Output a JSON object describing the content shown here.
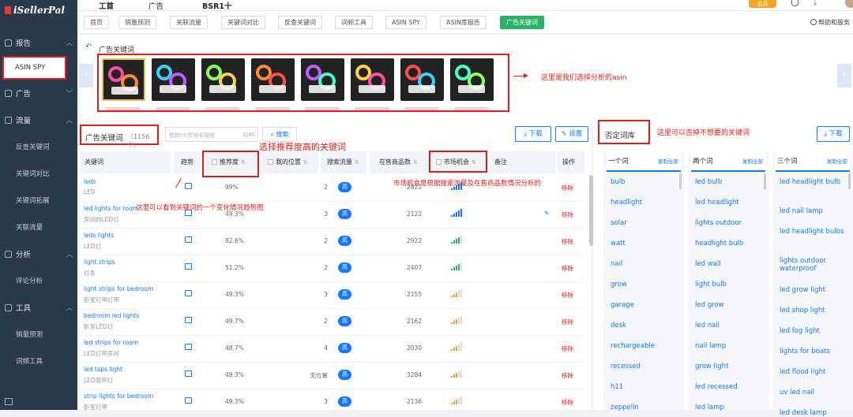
{
  "brand": {
    "name": "iSellerPal"
  },
  "sidebar": {
    "sections": [
      {
        "label": "报告",
        "items": [
          {
            "label": "ASIN SPY",
            "active": true
          }
        ]
      },
      {
        "label": "广告",
        "items": []
      },
      {
        "label": "流量",
        "items": [
          {
            "label": "反查关键词"
          },
          {
            "label": "关键词对比"
          },
          {
            "label": "关键词拓展"
          },
          {
            "label": "关联流量"
          }
        ]
      },
      {
        "label": "分析",
        "items": [
          {
            "label": "评论分析"
          }
        ]
      },
      {
        "label": "工具",
        "items": [
          {
            "label": "销量预测"
          },
          {
            "label": "词频工具"
          }
        ]
      }
    ]
  },
  "topbar": {
    "tabs": [
      "工首",
      "广告",
      "BSR1十"
    ],
    "vip_label": "会员",
    "user_badge": "..."
  },
  "nav": {
    "tabs": [
      "首页",
      "销量预测",
      "关联流量",
      "关键词对比",
      "反查关键词",
      "词频工具",
      "ASIN SPY",
      "ASIN库报告",
      "广告关键词"
    ],
    "active_index": 8,
    "help": "帮助和服务"
  },
  "products": {
    "title": "广告关键词",
    "count": 8,
    "annotation": "这里是我们选择分析的asin"
  },
  "keywords": {
    "title": "广告关键词",
    "count_label": "（1156个）",
    "search_placeholder": "模糊/大类搜索搜索",
    "search_count": "0/40",
    "search_btn": "搜索",
    "download": "下载",
    "settings": "设置",
    "annotation_rec": "选择推荐度高的关键词",
    "annotation_market": "市场机会是根据搜索流量及在售商品数情况分析的",
    "annotation_trend": "这里可以看到关键词的一个变化情况趋势图",
    "columns": {
      "keyword": "关键词",
      "trend": "趋势",
      "rec": "推荐度",
      "position": "我的位置",
      "source": "搜索流量",
      "count": "在售商品数",
      "market": "市场机会",
      "note": "备注",
      "action": "操作"
    },
    "rows": [
      {
        "en": "leds",
        "cn": "LED",
        "rec": "99%",
        "pos": "2",
        "src": "高",
        "cnt": "2822",
        "level": 5
      },
      {
        "en": "led lights for room",
        "cn": "房间的LED灯",
        "rec": "49.3%",
        "pos": "3",
        "src": "高",
        "cnt": "2122",
        "level": 5,
        "edit": true
      },
      {
        "en": "leds lights",
        "cn": "LED灯",
        "rec": "82.6%",
        "pos": "2",
        "src": "高",
        "cnt": "2922",
        "level": 4
      },
      {
        "en": "light strips",
        "cn": "灯条",
        "rec": "51.2%",
        "pos": "2",
        "src": "高",
        "cnt": "2407",
        "level": 4
      },
      {
        "en": "light strips for bedroom",
        "cn": "卧室灯带灯带",
        "rec": "49.3%",
        "pos": "3",
        "src": "高",
        "cnt": "2155",
        "level": 3
      },
      {
        "en": "bedroom led lights",
        "cn": "卧室LED灯",
        "rec": "49.7%",
        "pos": "2",
        "src": "高",
        "cnt": "2162",
        "level": 3
      },
      {
        "en": "led strips for room",
        "cn": "LED灯带房间",
        "rec": "48.7%",
        "pos": "4",
        "src": "高",
        "cnt": "2030",
        "level": 3
      },
      {
        "en": "led taps light",
        "cn": "LED面带灯",
        "rec": "49.3%",
        "pos": "无位置",
        "src": "高",
        "cnt": "3284",
        "level": 3
      },
      {
        "en": "strip lights for bedroom",
        "cn": "卧室灯带",
        "rec": "49.3%",
        "pos": "3",
        "src": "高",
        "cnt": "2136",
        "level": 3
      }
    ],
    "delete_label": "移除"
  },
  "negative": {
    "title": "否定词库",
    "annotation": "这里可以否掉不想要的关键词",
    "download": "下载",
    "select_all": "复制全部",
    "columns": [
      {
        "label": "一个词",
        "words": [
          "bulb",
          "headlight",
          "solar",
          "watt",
          "nail",
          "grow",
          "garage",
          "desk",
          "rechargeable",
          "recessed",
          "h11",
          "zeppelin"
        ]
      },
      {
        "label": "两个词",
        "words": [
          "led bulb",
          "led headlight",
          "lights outdoor",
          "headlight bulb",
          "led wall",
          "light bulb",
          "led grow",
          "led nail",
          "nail lamp",
          "grow light",
          "led recessed",
          "led lamp"
        ]
      },
      {
        "label": "三个词",
        "words": [
          "led headlight bulb",
          "led nail lamp",
          "led headlight bulbs",
          "lights outdoor waterproof",
          "led grow light",
          "led shop light",
          "led fog light",
          "lights for boats",
          "led flood light",
          "uv led nail",
          "led desk lamp"
        ]
      }
    ]
  },
  "colors": {
    "accent": "#1677ff",
    "active_nav": "#28b463",
    "annotation": "#e01e1e",
    "sidebar": "#2b3a4a"
  }
}
